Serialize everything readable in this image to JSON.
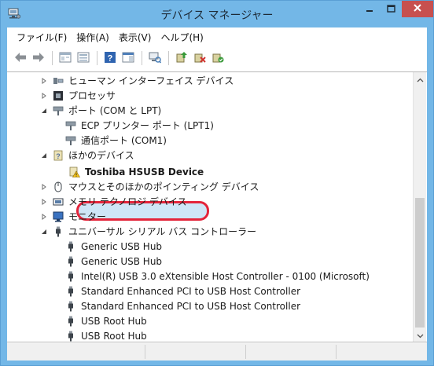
{
  "window": {
    "title": "デバイス マネージャー"
  },
  "menu": [
    "ファイル(F)",
    "操作(A)",
    "表示(V)",
    "ヘルプ(H)"
  ],
  "toolbar_icons": [
    "back-arrow-icon",
    "forward-arrow-icon",
    "properties-view-icon",
    "list-view-icon",
    "help-icon",
    "action-pane-icon",
    "scan-hardware-icon",
    "update-driver-icon",
    "uninstall-device-icon",
    "enable-device-icon"
  ],
  "tree": {
    "nodes": [
      {
        "label": "ヒューマン インターフェイス デバイス",
        "icon": "hid-icon",
        "state": "collapsed"
      },
      {
        "label": "プロセッサ",
        "icon": "processor-icon",
        "state": "collapsed"
      },
      {
        "label": "ポート (COM と LPT)",
        "icon": "port-icon",
        "state": "expanded"
      },
      {
        "label": "ECP プリンター ポート (LPT1)",
        "icon": "port-icon",
        "state": "leaf"
      },
      {
        "label": "通信ポート (COM1)",
        "icon": "port-icon",
        "state": "leaf"
      },
      {
        "label": "ほかのデバイス",
        "icon": "unknown-device-icon",
        "state": "expanded"
      },
      {
        "label": "Toshiba HSUSB Device",
        "icon": "warning-device-icon",
        "state": "leaf",
        "selected": true
      },
      {
        "label": "マウスとそのほかのポインティング デバイス",
        "icon": "mouse-icon",
        "state": "collapsed"
      },
      {
        "label": "メモリ テクノロジ デバイス",
        "icon": "memory-icon",
        "state": "collapsed"
      },
      {
        "label": "モニター",
        "icon": "monitor-icon",
        "state": "collapsed"
      },
      {
        "label": "ユニバーサル シリアル バス コントローラー",
        "icon": "usb-icon",
        "state": "expanded"
      },
      {
        "label": "Generic USB Hub",
        "icon": "usb-icon",
        "state": "leaf"
      },
      {
        "label": "Generic USB Hub",
        "icon": "usb-icon",
        "state": "leaf"
      },
      {
        "label": "Intel(R) USB 3.0 eXtensible Host Controller - 0100 (Microsoft)",
        "icon": "usb-icon",
        "state": "leaf"
      },
      {
        "label": "Standard Enhanced PCI to USB Host Controller",
        "icon": "usb-icon",
        "state": "leaf"
      },
      {
        "label": "Standard Enhanced PCI to USB Host Controller",
        "icon": "usb-icon",
        "state": "leaf"
      },
      {
        "label": "USB Root Hub",
        "icon": "usb-icon",
        "state": "leaf"
      },
      {
        "label": "USB Root Hub",
        "icon": "usb-icon",
        "state": "leaf"
      }
    ]
  },
  "colors": {
    "titlebar": "#73b7e7",
    "close_button": "#c7504f",
    "highlight_ring": "#e4243a",
    "selection": "#cfe6f7"
  }
}
